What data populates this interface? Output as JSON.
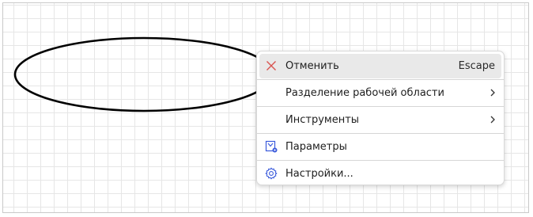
{
  "canvas": {
    "shape": "ellipse"
  },
  "context_menu": {
    "items": [
      {
        "label": "Отменить",
        "shortcut": "Escape",
        "icon": "close-icon",
        "icon_color": "#d9534f"
      },
      {
        "label": "Разделение рабочей области",
        "submenu": true
      },
      {
        "label": "Инструменты",
        "submenu": true
      },
      {
        "label": "Параметры",
        "icon": "parameters-icon",
        "icon_color": "#3b5bdb"
      },
      {
        "label": "Настройки...",
        "icon": "gear-icon",
        "icon_color": "#3b5bdb"
      }
    ]
  }
}
